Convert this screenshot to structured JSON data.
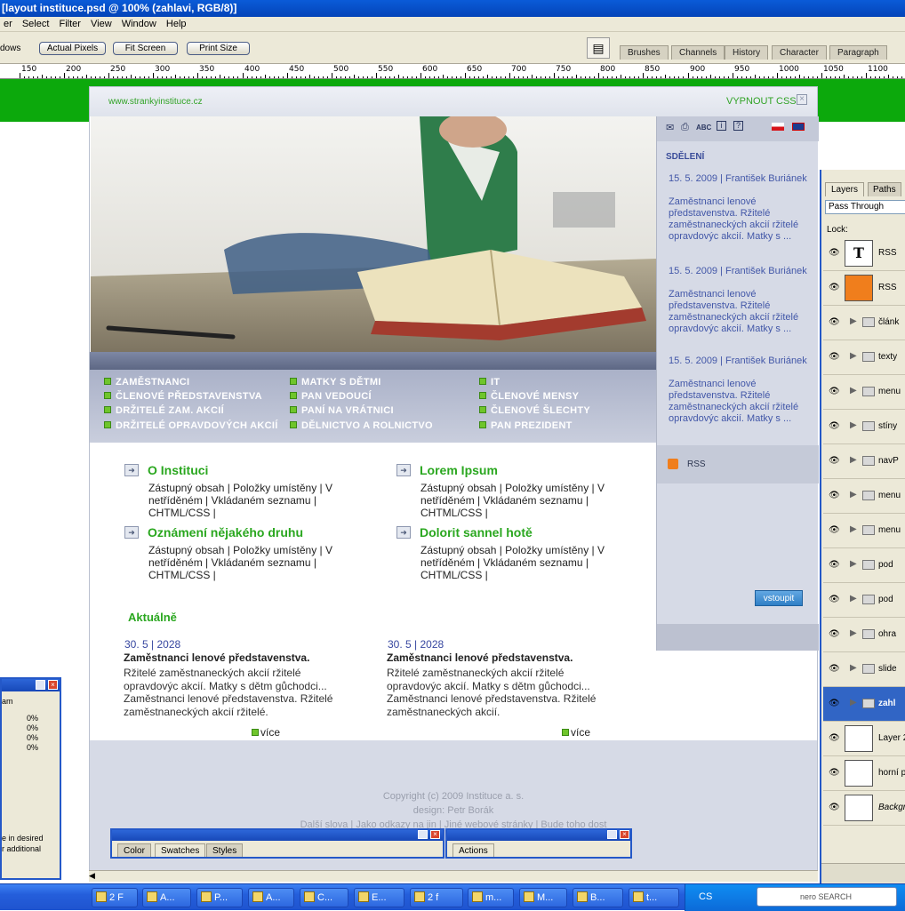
{
  "titlebar": {
    "title": "[layout instituce.psd @ 100% (zahlavi, RGB/8)]"
  },
  "menubar": {
    "items": [
      "er",
      "Select",
      "Filter",
      "View",
      "Window",
      "Help"
    ]
  },
  "options": {
    "windows": "dows",
    "actual_pixels": "Actual Pixels",
    "fit_screen": "Fit Screen",
    "print_size": "Print Size"
  },
  "dock_tabs": [
    "Brushes",
    "Channels",
    "History",
    "Character",
    "Paragraph"
  ],
  "ruler": [
    "150",
    "200",
    "250",
    "300",
    "350",
    "400",
    "450",
    "500",
    "550",
    "600",
    "650",
    "700",
    "750",
    "800",
    "850",
    "900",
    "950",
    "1000",
    "1050",
    "1100"
  ],
  "site": {
    "domain": "www.strankyinstituce.cz",
    "css_toggle": "VYPNOUT CSS",
    "nav": [
      [
        "ZAMĚSTNANCI",
        "ČLENOVÉ PŘEDSTAVENSTVA",
        "DRŽITELÉ ZAM. AKCIÍ",
        "DRŽITELÉ OPRAVDOVÝCH AKCIÍ"
      ],
      [
        "MATKY S DĚTMI",
        "PAN VEDOUCÍ",
        "PANÍ NA VRÁTNICI",
        "DĚLNICTVO A ROLNICTVO"
      ],
      [
        "IT",
        "ČLENOVÉ MENSY",
        "ČLENOVÉ ŠLECHTY",
        "PAN PREZIDENT"
      ]
    ],
    "sections": [
      {
        "title": "O Instituci",
        "body": "Zástupný obsah | Položky umístěny | V netříděném | Vkládaném seznamu | CHTML/CSS |"
      },
      {
        "title": "Lorem Ipsum",
        "body": "Zástupný obsah | Položky umístěny | V netříděném | Vkládaném seznamu | CHTML/CSS |"
      },
      {
        "title": "Oznámení nějakého druhu",
        "body": "Zástupný obsah | Položky umístěny | V netříděném | Vkládaném seznamu | CHTML/CSS |"
      },
      {
        "title": "Dolorit sannel hotě",
        "body": "Zástupný obsah | Položky umístěny | V netříděném | Vkládaném seznamu | CHTML/CSS |"
      }
    ],
    "news_heading": "Aktuálně",
    "news": [
      {
        "date": "30. 5 | 2028",
        "title": "Zaměstnanci lenové představenstva.",
        "body": "Ržitelé zaměstnaneckých akcií ržitelé opravdovýc akcií. Matky s dětm gůchodci... Zaměstnanci lenové představenstva. Ržitelé zaměstnaneckých akcií ržitelé.",
        "more": "více"
      },
      {
        "date": "30. 5 | 2028",
        "title": "Zaměstnanci lenové představenstva.",
        "body": "Ržitelé zaměstnaneckých akcií ržitelé opravdovýc akcií. Matky s dětm gůchodci... Zaměstnanci lenové představenstva. Ržitelé zaměstnaneckých akcií.",
        "more": "více"
      }
    ],
    "sidebar": {
      "heading": "SDĚLENÍ",
      "items": [
        {
          "meta": "15. 5. 2009 | František Buriánek",
          "text": "Zaměstnanci lenové představenstva. Ržitelé zaměstnaneckých akcií ržitelé opravdovýc akcií. Matky s ..."
        },
        {
          "meta": "15. 5. 2009 | František Buriánek",
          "text": "Zaměstnanci lenové představenstva. Ržitelé zaměstnaneckých akcií ržitelé opravdovýc akcií. Matky s ..."
        },
        {
          "meta": "15. 5. 2009 | František Buriánek",
          "text": "Zaměstnanci lenové představenstva. Ržitelé zaměstnaneckých akcií ržitelé opravdovýc akcií. Matky s ..."
        }
      ],
      "rss": "RSS",
      "login": "vstoupit",
      "icon_abc": "ABC"
    },
    "footer": {
      "copyright": "Copyright (c) 2009 Instituce a. s.",
      "design": "design: Petr Borák",
      "links": "Další slova | Jako odkazy na jin | Jiné webové stránky | Bude toho dost"
    }
  },
  "layers": {
    "tabs": [
      "Layers",
      "Paths"
    ],
    "blend": "Pass Through",
    "lock": "Lock:",
    "rows": [
      "RSS",
      "RSS",
      "článk",
      "texty",
      "menu",
      "stíny",
      "navP",
      "menu",
      "menu",
      "pod",
      "pod",
      "ohra",
      "slide",
      "zahl",
      "Layer 2",
      "horní p",
      "Backgr"
    ]
  },
  "panel_left": {
    "rows": [
      "0%",
      "0%",
      "0%",
      "0%"
    ],
    "label": "am",
    "note1": "e in desired",
    "note2": "r additional"
  },
  "float_panels": {
    "tabs1": [
      "Color",
      "Swatches",
      "Styles"
    ],
    "tabs2": [
      "Actions"
    ]
  },
  "taskbar": {
    "buttons": [
      "2 F",
      "A...",
      "P...",
      "A...",
      "C...",
      "E...",
      "2 f",
      "m...",
      "M...",
      "B...",
      "t..."
    ],
    "lang": "CS",
    "search": "nero SEARCH"
  }
}
